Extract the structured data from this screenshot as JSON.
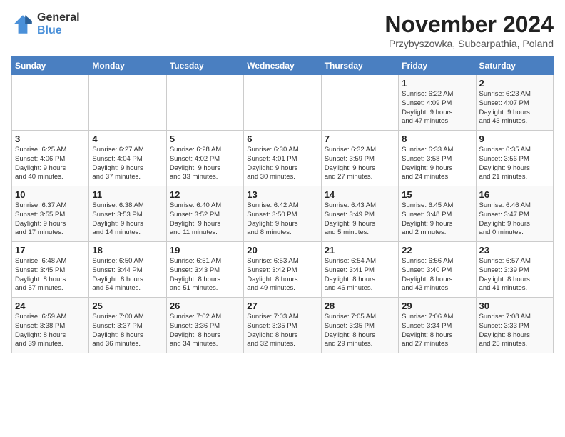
{
  "logo": {
    "general": "General",
    "blue": "Blue"
  },
  "title": "November 2024",
  "subtitle": "Przybyszowka, Subcarpathia, Poland",
  "headers": [
    "Sunday",
    "Monday",
    "Tuesday",
    "Wednesday",
    "Thursday",
    "Friday",
    "Saturday"
  ],
  "weeks": [
    [
      {
        "day": "",
        "info": ""
      },
      {
        "day": "",
        "info": ""
      },
      {
        "day": "",
        "info": ""
      },
      {
        "day": "",
        "info": ""
      },
      {
        "day": "",
        "info": ""
      },
      {
        "day": "1",
        "info": "Sunrise: 6:22 AM\nSunset: 4:09 PM\nDaylight: 9 hours\nand 47 minutes."
      },
      {
        "day": "2",
        "info": "Sunrise: 6:23 AM\nSunset: 4:07 PM\nDaylight: 9 hours\nand 43 minutes."
      }
    ],
    [
      {
        "day": "3",
        "info": "Sunrise: 6:25 AM\nSunset: 4:06 PM\nDaylight: 9 hours\nand 40 minutes."
      },
      {
        "day": "4",
        "info": "Sunrise: 6:27 AM\nSunset: 4:04 PM\nDaylight: 9 hours\nand 37 minutes."
      },
      {
        "day": "5",
        "info": "Sunrise: 6:28 AM\nSunset: 4:02 PM\nDaylight: 9 hours\nand 33 minutes."
      },
      {
        "day": "6",
        "info": "Sunrise: 6:30 AM\nSunset: 4:01 PM\nDaylight: 9 hours\nand 30 minutes."
      },
      {
        "day": "7",
        "info": "Sunrise: 6:32 AM\nSunset: 3:59 PM\nDaylight: 9 hours\nand 27 minutes."
      },
      {
        "day": "8",
        "info": "Sunrise: 6:33 AM\nSunset: 3:58 PM\nDaylight: 9 hours\nand 24 minutes."
      },
      {
        "day": "9",
        "info": "Sunrise: 6:35 AM\nSunset: 3:56 PM\nDaylight: 9 hours\nand 21 minutes."
      }
    ],
    [
      {
        "day": "10",
        "info": "Sunrise: 6:37 AM\nSunset: 3:55 PM\nDaylight: 9 hours\nand 17 minutes."
      },
      {
        "day": "11",
        "info": "Sunrise: 6:38 AM\nSunset: 3:53 PM\nDaylight: 9 hours\nand 14 minutes."
      },
      {
        "day": "12",
        "info": "Sunrise: 6:40 AM\nSunset: 3:52 PM\nDaylight: 9 hours\nand 11 minutes."
      },
      {
        "day": "13",
        "info": "Sunrise: 6:42 AM\nSunset: 3:50 PM\nDaylight: 9 hours\nand 8 minutes."
      },
      {
        "day": "14",
        "info": "Sunrise: 6:43 AM\nSunset: 3:49 PM\nDaylight: 9 hours\nand 5 minutes."
      },
      {
        "day": "15",
        "info": "Sunrise: 6:45 AM\nSunset: 3:48 PM\nDaylight: 9 hours\nand 2 minutes."
      },
      {
        "day": "16",
        "info": "Sunrise: 6:46 AM\nSunset: 3:47 PM\nDaylight: 9 hours\nand 0 minutes."
      }
    ],
    [
      {
        "day": "17",
        "info": "Sunrise: 6:48 AM\nSunset: 3:45 PM\nDaylight: 8 hours\nand 57 minutes."
      },
      {
        "day": "18",
        "info": "Sunrise: 6:50 AM\nSunset: 3:44 PM\nDaylight: 8 hours\nand 54 minutes."
      },
      {
        "day": "19",
        "info": "Sunrise: 6:51 AM\nSunset: 3:43 PM\nDaylight: 8 hours\nand 51 minutes."
      },
      {
        "day": "20",
        "info": "Sunrise: 6:53 AM\nSunset: 3:42 PM\nDaylight: 8 hours\nand 49 minutes."
      },
      {
        "day": "21",
        "info": "Sunrise: 6:54 AM\nSunset: 3:41 PM\nDaylight: 8 hours\nand 46 minutes."
      },
      {
        "day": "22",
        "info": "Sunrise: 6:56 AM\nSunset: 3:40 PM\nDaylight: 8 hours\nand 43 minutes."
      },
      {
        "day": "23",
        "info": "Sunrise: 6:57 AM\nSunset: 3:39 PM\nDaylight: 8 hours\nand 41 minutes."
      }
    ],
    [
      {
        "day": "24",
        "info": "Sunrise: 6:59 AM\nSunset: 3:38 PM\nDaylight: 8 hours\nand 39 minutes."
      },
      {
        "day": "25",
        "info": "Sunrise: 7:00 AM\nSunset: 3:37 PM\nDaylight: 8 hours\nand 36 minutes."
      },
      {
        "day": "26",
        "info": "Sunrise: 7:02 AM\nSunset: 3:36 PM\nDaylight: 8 hours\nand 34 minutes."
      },
      {
        "day": "27",
        "info": "Sunrise: 7:03 AM\nSunset: 3:35 PM\nDaylight: 8 hours\nand 32 minutes."
      },
      {
        "day": "28",
        "info": "Sunrise: 7:05 AM\nSunset: 3:35 PM\nDaylight: 8 hours\nand 29 minutes."
      },
      {
        "day": "29",
        "info": "Sunrise: 7:06 AM\nSunset: 3:34 PM\nDaylight: 8 hours\nand 27 minutes."
      },
      {
        "day": "30",
        "info": "Sunrise: 7:08 AM\nSunset: 3:33 PM\nDaylight: 8 hours\nand 25 minutes."
      }
    ]
  ]
}
